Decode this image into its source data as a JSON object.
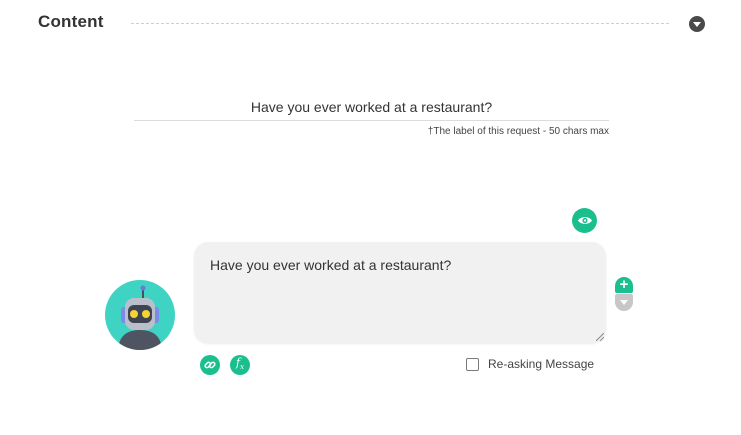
{
  "section": {
    "title": "Content"
  },
  "label": {
    "value": "Have you ever worked at a restaurant?",
    "hint": "†The label of this request - 50 chars max"
  },
  "message": {
    "text": "Have you ever worked at a restaurant?"
  },
  "options": {
    "reask_label": "Re-asking Message",
    "reask_checked": false
  },
  "icons": {
    "collapse": "caret-down-icon",
    "preview": "eye-icon",
    "avatar": "robot-icon",
    "add": "plus-icon",
    "move_down": "caret-down-icon",
    "link": "link-icon",
    "function": "fx-icon"
  },
  "colors": {
    "accent": "#1bbf8d",
    "avatar_bg": "#3ed3c2",
    "message_bg": "#f1f1f1"
  }
}
